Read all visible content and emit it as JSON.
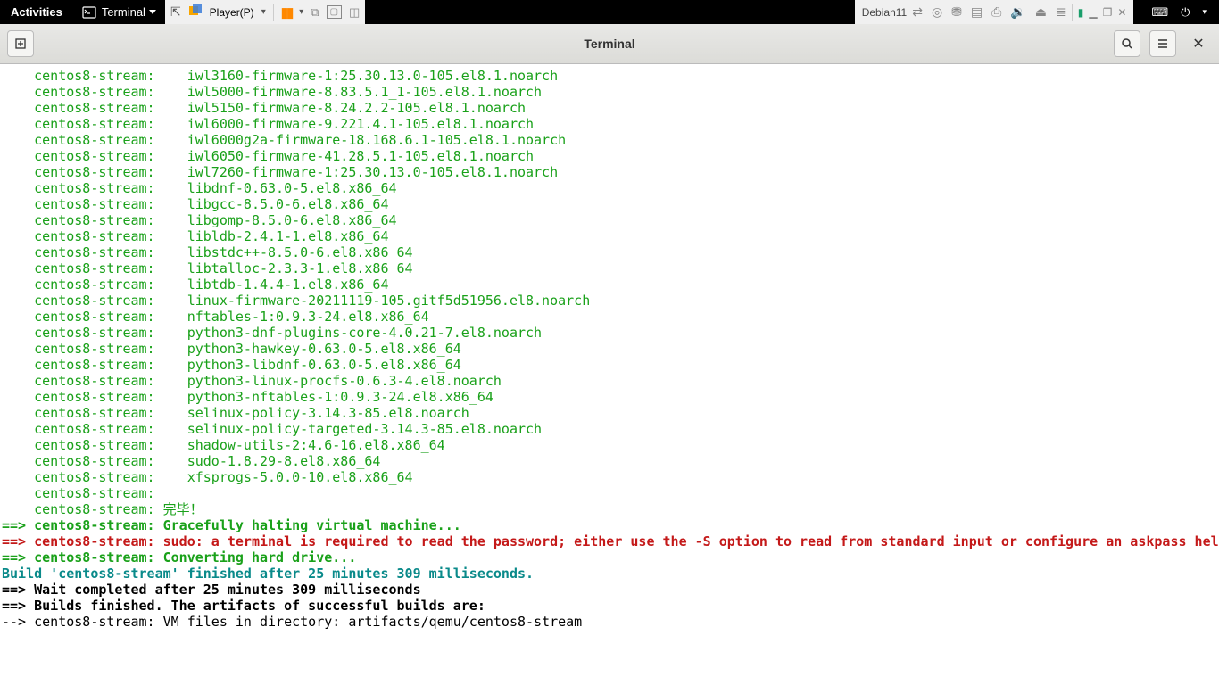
{
  "topbar": {
    "activities": "Activities",
    "terminal_label": "Terminal",
    "player_label": "Player(P)",
    "vm_name": "Debian11"
  },
  "window": {
    "title": "Terminal"
  },
  "prefix": "    centos8-stream: ",
  "packages": [
    "iwl3160-firmware-1:25.30.13.0-105.el8.1.noarch",
    "iwl5000-firmware-8.83.5.1_1-105.el8.1.noarch",
    "iwl5150-firmware-8.24.2.2-105.el8.1.noarch",
    "iwl6000-firmware-9.221.4.1-105.el8.1.noarch",
    "iwl6000g2a-firmware-18.168.6.1-105.el8.1.noarch",
    "iwl6050-firmware-41.28.5.1-105.el8.1.noarch",
    "iwl7260-firmware-1:25.30.13.0-105.el8.1.noarch",
    "libdnf-0.63.0-5.el8.x86_64",
    "libgcc-8.5.0-6.el8.x86_64",
    "libgomp-8.5.0-6.el8.x86_64",
    "libldb-2.4.1-1.el8.x86_64",
    "libstdc++-8.5.0-6.el8.x86_64",
    "libtalloc-2.3.3-1.el8.x86_64",
    "libtdb-1.4.4-1.el8.x86_64",
    "linux-firmware-20211119-105.gitf5d51956.el8.noarch",
    "nftables-1:0.9.3-24.el8.x86_64",
    "python3-dnf-plugins-core-4.0.21-7.el8.noarch",
    "python3-hawkey-0.63.0-5.el8.x86_64",
    "python3-libdnf-0.63.0-5.el8.x86_64",
    "python3-linux-procfs-0.6.3-4.el8.noarch",
    "python3-nftables-1:0.9.3-24.el8.x86_64",
    "selinux-policy-3.14.3-85.el8.noarch",
    "selinux-policy-targeted-3.14.3-85.el8.noarch",
    "shadow-utils-2:4.6-16.el8.x86_64",
    "sudo-1.8.29-8.el8.x86_64",
    "xfsprogs-5.0.0-10.el8.x86_64"
  ],
  "tail_lines": {
    "empty_prefix": "    centos8-stream:",
    "done": "    centos8-stream: 完毕！",
    "halt": "==> centos8-stream: Gracefully halting virtual machine...",
    "sudo": "==> centos8-stream: sudo: a terminal is required to read the password; either use the -S option to read from standard input or configure an askpass helper",
    "convert": "==> centos8-stream: Converting hard drive...",
    "build_done": "Build 'centos8-stream' finished after 25 minutes 309 milliseconds.",
    "blank": "",
    "wait": "==> Wait completed after 25 minutes 309 milliseconds",
    "builds_finished": "==> Builds finished. The artifacts of successful builds are:",
    "artifact": "--> centos8-stream: VM files in directory: artifacts/qemu/centos8-stream"
  }
}
